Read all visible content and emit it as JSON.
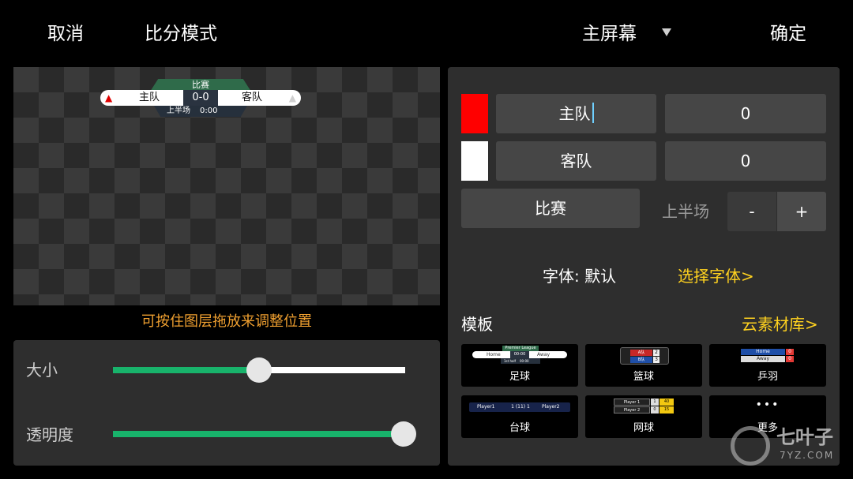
{
  "topbar": {
    "cancel": "取消",
    "mode": "比分模式",
    "screen": "主屏幕",
    "confirm": "确定"
  },
  "preview": {
    "title": "比赛",
    "home": "主队",
    "score": "0-0",
    "away": "客队",
    "period": "上半场",
    "clock": "0:00",
    "hint": "可按住图层拖放来调整位置"
  },
  "sliders": {
    "size_label": "大小",
    "size_value": 0.5,
    "opacity_label": "透明度",
    "opacity_value": 1.0
  },
  "editor": {
    "home_color": "#ff0000",
    "away_color": "#ffffff",
    "home_name": "主队",
    "home_score": "0",
    "away_name": "客队",
    "away_score": "0",
    "match_name": "比赛",
    "period": "上半场",
    "minus": "-",
    "plus": "+",
    "font_label": "字体: 默认",
    "font_link": "选择字体>",
    "templates_label": "模板",
    "library_link": "云素材库>"
  },
  "templates": [
    {
      "name": "足球",
      "thumb": {
        "league": "Premier League",
        "home": "Home",
        "score": "00-00",
        "away": "Away",
        "period": "1st half",
        "clock": "00:00"
      }
    },
    {
      "name": "篮球",
      "thumb": {
        "team1": "A队",
        "score1": "2",
        "team2": "B队",
        "score2": "3"
      }
    },
    {
      "name": "乒羽",
      "thumb": {
        "team1": "Home",
        "score1": "0",
        "team2": "Away",
        "score2": "0"
      }
    },
    {
      "name": "台球",
      "thumb": {
        "player1": "Player1",
        "frames": "1 (11) 1",
        "player2": "Player2"
      }
    },
    {
      "name": "网球",
      "thumb": {
        "player1": "Player 1",
        "s1": "1",
        "p1": "40",
        "player2": "Player 2",
        "s2": "0",
        "p2": "15"
      }
    },
    {
      "name": "更多",
      "thumb": {
        "dots": "•••"
      }
    }
  ],
  "watermark": {
    "name": "七叶子",
    "url": "7YZ.COM"
  },
  "icons": {
    "dropdown": "triangle-down-icon",
    "home_shirt": "shirt-icon",
    "away_shirt": "shirt-icon"
  },
  "colors": {
    "accent_green": "#18b36b",
    "link_yellow": "#ffd21f",
    "hint_orange": "#f0a030"
  }
}
